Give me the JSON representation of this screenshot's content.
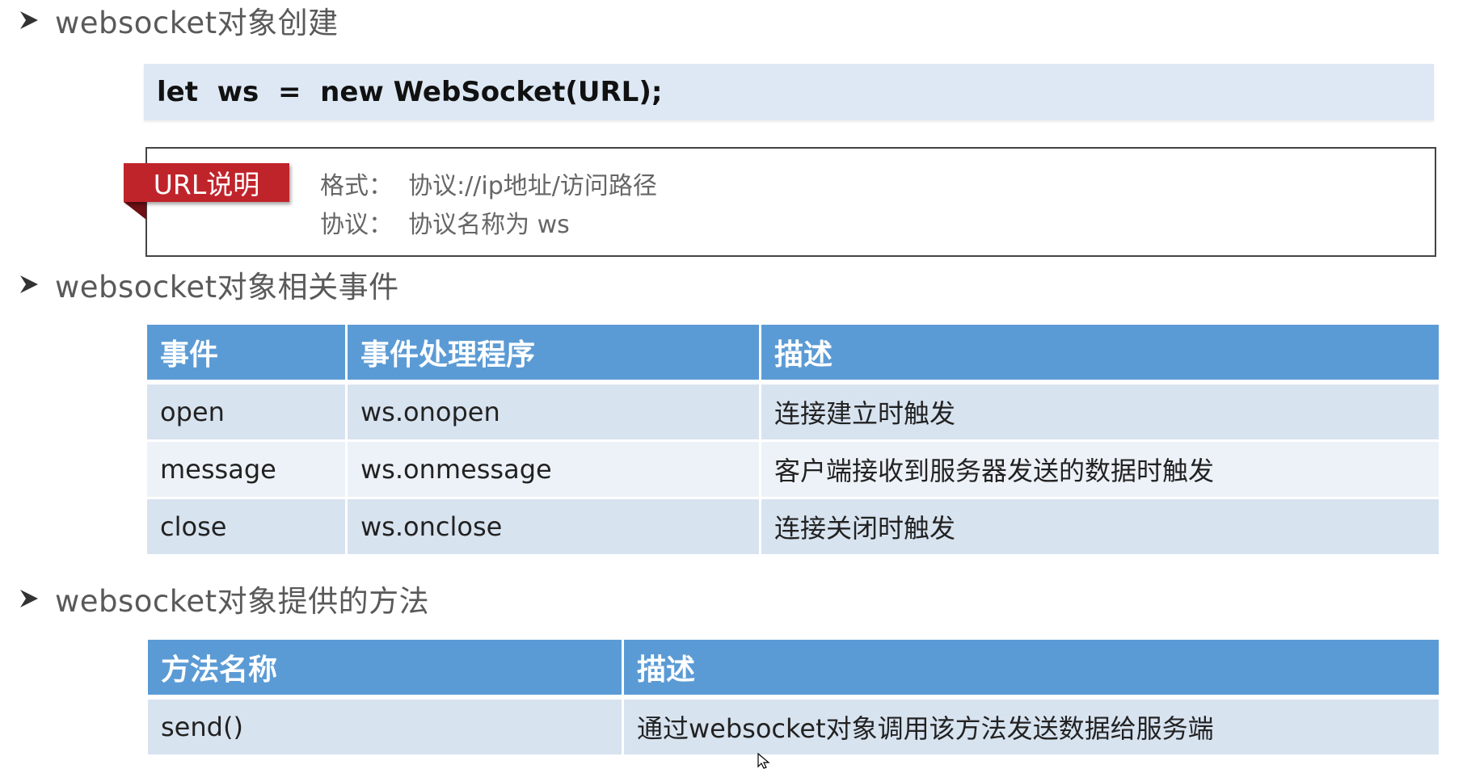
{
  "sections": {
    "create": {
      "heading": "websocket对象创建"
    },
    "events": {
      "heading": "websocket对象相关事件"
    },
    "methods": {
      "heading": "websocket对象提供的方法"
    }
  },
  "code": {
    "line": "let  ws  =  new WebSocket(URL);"
  },
  "url_note": {
    "tag": "URL说明",
    "lines": [
      "格式：  协议://ip地址/访问路径",
      "协议：  协议名称为 ws"
    ]
  },
  "events_table": {
    "headers": [
      "事件",
      "事件处理程序",
      "描述"
    ],
    "rows": [
      [
        "open",
        "ws.onopen",
        "连接建立时触发"
      ],
      [
        "message",
        "ws.onmessage",
        "客户端接收到服务器发送的数据时触发"
      ],
      [
        "close",
        "ws.onclose",
        "连接关闭时触发"
      ]
    ]
  },
  "methods_table": {
    "headers": [
      "方法名称",
      "描述"
    ],
    "rows": [
      [
        "send()",
        "通过websocket对象调用该方法发送数据给服务端"
      ]
    ]
  },
  "colors": {
    "header_blue": "#5b9bd5",
    "row_dark": "#d8e3f0",
    "row_light": "#edf2f8",
    "code_bg": "#dde8f4",
    "tag_red": "#c0242b"
  },
  "icons": {
    "bullet": "arrow-bullet-icon",
    "cursor": "mouse-pointer-icon"
  }
}
